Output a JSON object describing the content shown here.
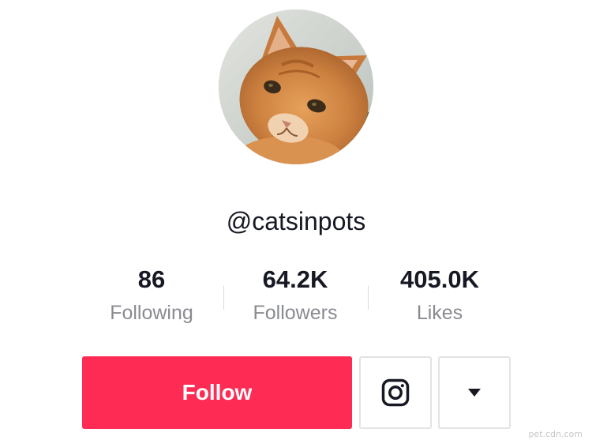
{
  "profile": {
    "username": "@catsinpots",
    "avatar_icon": "orange-tabby-cat-avatar"
  },
  "stats": [
    {
      "value": "86",
      "label": "Following"
    },
    {
      "value": "64.2K",
      "label": "Followers"
    },
    {
      "value": "405.0K",
      "label": "Likes"
    }
  ],
  "actions": {
    "follow_label": "Follow",
    "instagram_icon": "instagram-icon",
    "more_icon": "caret-down-icon"
  },
  "colors": {
    "accent": "#fe2c55",
    "text_primary": "#161823",
    "text_secondary": "#8a8b91"
  },
  "watermark": "pet.cdn.com"
}
